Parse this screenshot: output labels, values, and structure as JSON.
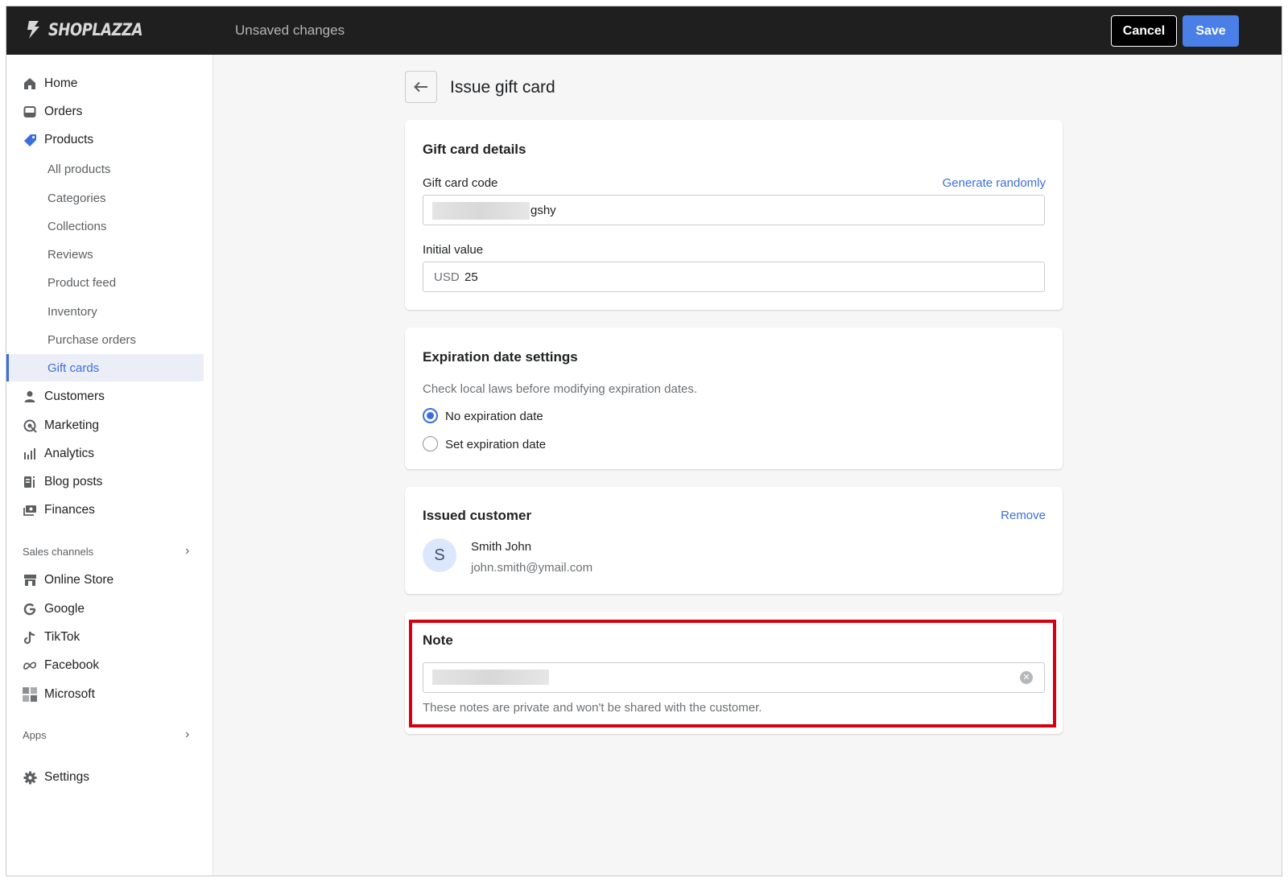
{
  "brand": {
    "logo_text": "SHOPLAZZA"
  },
  "topbar": {
    "status": "Unsaved changes",
    "cancel_label": "Cancel",
    "save_label": "Save"
  },
  "sidebar": {
    "items": [
      {
        "label": "Home",
        "icon": "home-icon"
      },
      {
        "label": "Orders",
        "icon": "inbox-icon"
      },
      {
        "label": "Products",
        "icon": "tag-icon"
      }
    ],
    "product_subitems": [
      {
        "label": "All products"
      },
      {
        "label": "Categories"
      },
      {
        "label": "Collections"
      },
      {
        "label": "Reviews"
      },
      {
        "label": "Product feed"
      },
      {
        "label": "Inventory"
      },
      {
        "label": "Purchase orders"
      },
      {
        "label": "Gift cards",
        "active": true
      }
    ],
    "items2": [
      {
        "label": "Customers",
        "icon": "person-icon"
      },
      {
        "label": "Marketing",
        "icon": "target-icon"
      },
      {
        "label": "Analytics",
        "icon": "bar-chart-icon"
      },
      {
        "label": "Blog posts",
        "icon": "blog-icon"
      },
      {
        "label": "Finances",
        "icon": "money-icon"
      }
    ],
    "sales_channels_label": "Sales channels",
    "channels": [
      {
        "label": "Online Store",
        "icon": "store-icon"
      },
      {
        "label": "Google",
        "icon": "google-icon"
      },
      {
        "label": "TikTok",
        "icon": "tiktok-icon"
      },
      {
        "label": "Facebook",
        "icon": "meta-icon"
      },
      {
        "label": "Microsoft",
        "icon": "microsoft-icon"
      }
    ],
    "apps_label": "Apps",
    "settings_label": "Settings"
  },
  "page": {
    "title": "Issue gift card"
  },
  "gift_card_details": {
    "title": "Gift card details",
    "code_label": "Gift card code",
    "generate_link": "Generate randomly",
    "code_value_visible": "gshy",
    "initial_value_label": "Initial value",
    "currency": "USD",
    "initial_value": "25"
  },
  "expiration": {
    "title": "Expiration date settings",
    "hint": "Check local laws before modifying expiration dates.",
    "options": [
      {
        "label": "No expiration date",
        "checked": true
      },
      {
        "label": "Set expiration date",
        "checked": false
      }
    ]
  },
  "issued_customer": {
    "title": "Issued customer",
    "remove_link": "Remove",
    "avatar_initial": "S",
    "name": "Smith John",
    "email": "john.smith@ymail.com"
  },
  "note": {
    "title": "Note",
    "help": "These notes are private and won't be shared with the customer."
  },
  "colors": {
    "accent": "#3b6fe0",
    "save_button": "#4a7fe8",
    "topbar": "#1f1f1f",
    "highlight": "#d7000f"
  }
}
